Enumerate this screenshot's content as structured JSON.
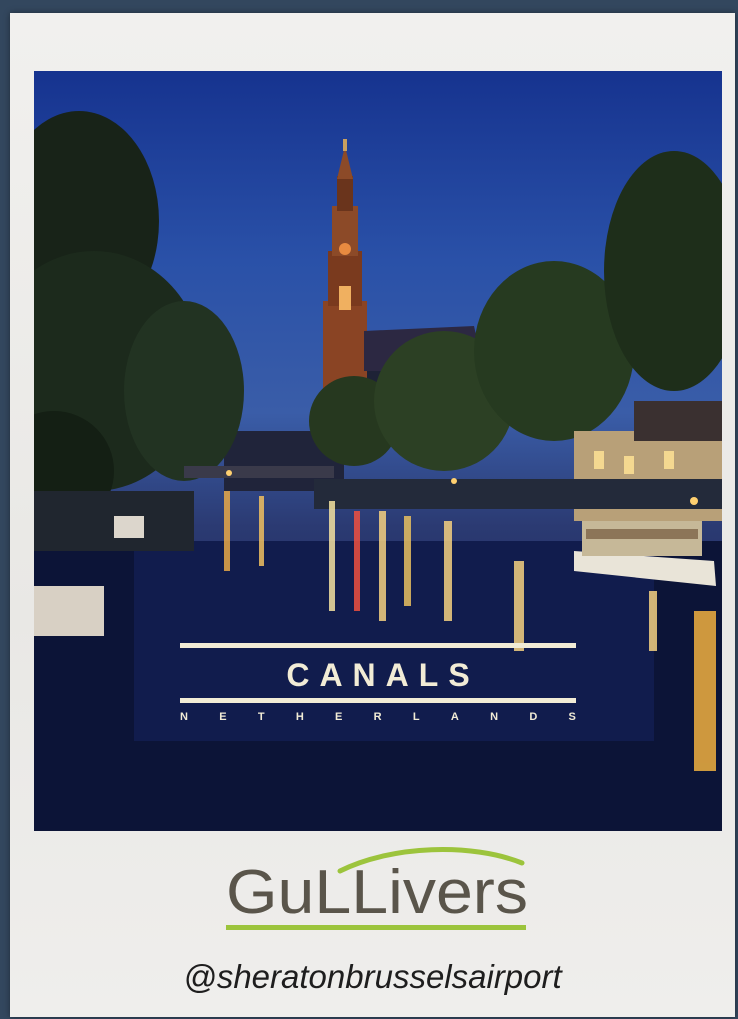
{
  "poster": {
    "title": "CANALS",
    "country_letters": [
      "N",
      "E",
      "T",
      "H",
      "E",
      "R",
      "L",
      "A",
      "N",
      "D",
      "S"
    ],
    "brand": "GuLLivers",
    "handle": "@sheratonbrusselsairport"
  },
  "colors": {
    "background": "#33475e",
    "card": "#efeeec",
    "sky": "#1f44a0",
    "title_text": "#f2ecd6",
    "brand_grey": "#5a554b",
    "brand_green": "#9cc43c"
  }
}
